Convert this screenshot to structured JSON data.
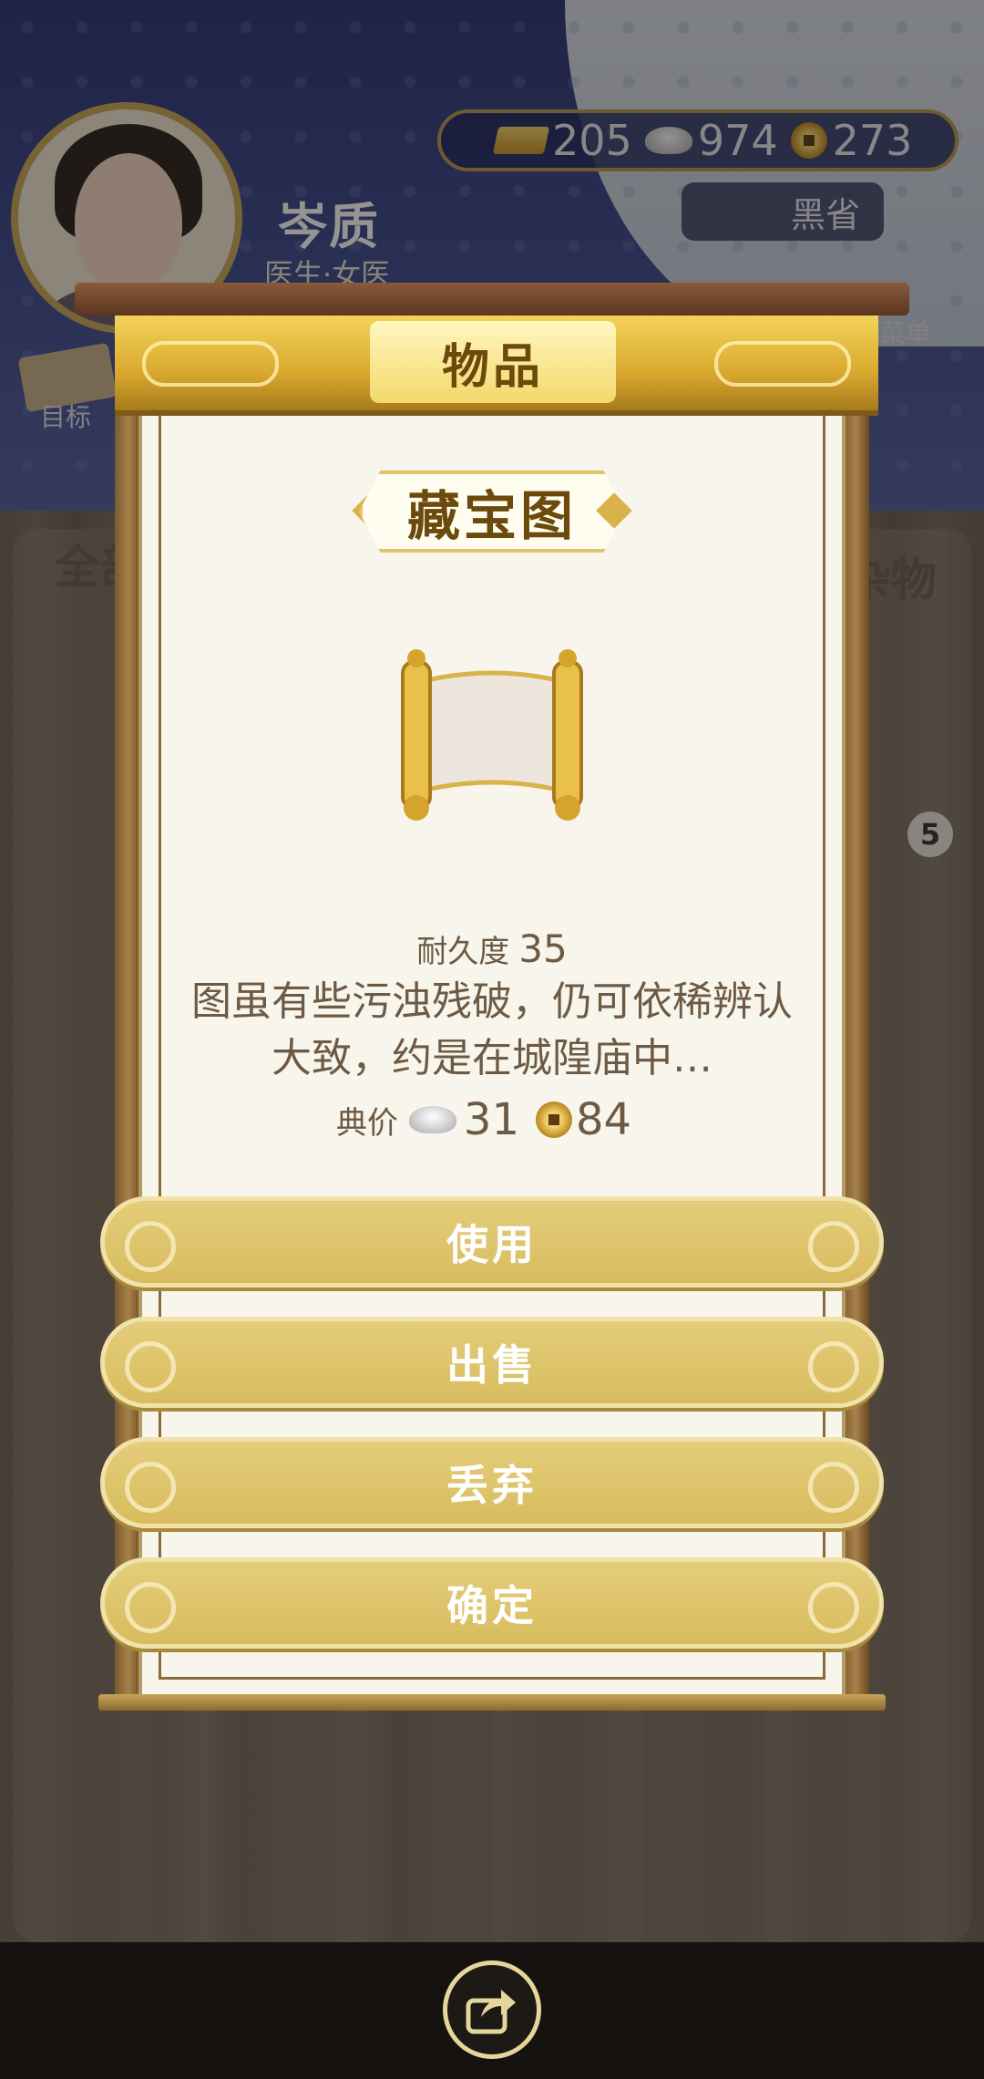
{
  "profile": {
    "name": "岑质",
    "role": "医生·女医"
  },
  "resources": {
    "gold": "205",
    "silver": "974",
    "coins": "273"
  },
  "region": "黑省",
  "nav": {
    "goal_label": "目标",
    "menu_label": "菜单"
  },
  "tabs": {
    "left": "全部",
    "right": "杂物"
  },
  "inventory_count": "5",
  "dialog": {
    "title": "物品",
    "item_name": "藏宝图",
    "durability_label": "耐久度",
    "durability_value": "35",
    "description": "图虽有些污浊残破，仍可依稀辨认大致，约是在城隍庙中…",
    "price_label": "典价",
    "price_silver": "31",
    "price_coins": "84"
  },
  "actions": [
    {
      "label": "使用"
    },
    {
      "label": "出售"
    },
    {
      "label": "丢弃"
    },
    {
      "label": "确定"
    }
  ],
  "icons": {
    "gold": "gold-bar-icon",
    "silver": "silver-ingot-icon",
    "coin": "copper-coin-icon",
    "share": "share-icon",
    "item": "treasure-map-scroll-icon"
  },
  "colors": {
    "banner": "#f4d35a",
    "button": "#e4cd7a",
    "paper": "#f8f6ec",
    "text": "#6e5a44"
  }
}
